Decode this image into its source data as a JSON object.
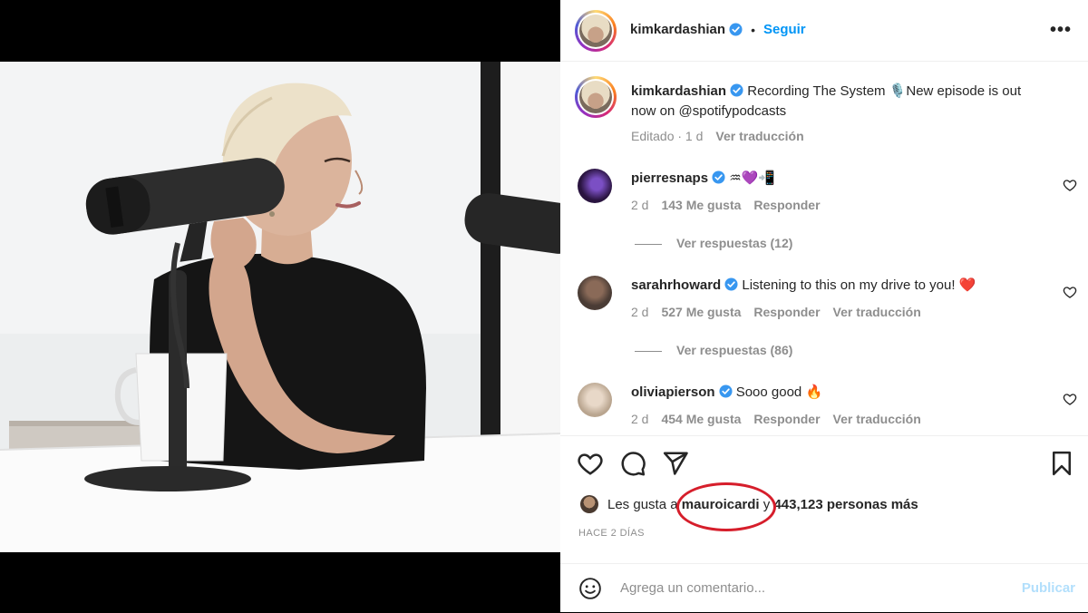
{
  "post": {
    "author": "kimkardashian",
    "follow_label": "Seguir",
    "more_label": "•••",
    "caption_text": "Recording The System 🎙️New episode is out now on @spotifypodcasts",
    "caption_meta_edited": "Editado · 1 d",
    "caption_translate": "Ver traducción"
  },
  "comments": [
    {
      "user": "pierresnaps",
      "text": "♒💜📲",
      "age": "2 d",
      "likes": "143 Me gusta",
      "reply": "Responder",
      "translate": "",
      "view_replies": "Ver respuestas (12)"
    },
    {
      "user": "sarahrhoward",
      "text": "Listening to this on my drive to you! ❤️",
      "age": "2 d",
      "likes": "527 Me gusta",
      "reply": "Responder",
      "translate": "Ver traducción",
      "view_replies": "Ver respuestas (86)"
    },
    {
      "user": "oliviapierson",
      "text": "Sooo good 🔥",
      "age": "2 d",
      "likes": "454 Me gusta",
      "reply": "Responder",
      "translate": "Ver traducción",
      "view_replies": ""
    }
  ],
  "likes": {
    "prefix": "Les gusta a",
    "user": "mauroicardi",
    "suffix": "y",
    "rest": "443,123 personas más"
  },
  "time_ago": "HACE 2 DÍAS",
  "add_comment": {
    "placeholder": "Agrega un comentario...",
    "publish_label": "Publicar"
  },
  "colors": {
    "accent": "#0095f6",
    "verified": "#3897f0",
    "annotation": "#d61e2b"
  }
}
